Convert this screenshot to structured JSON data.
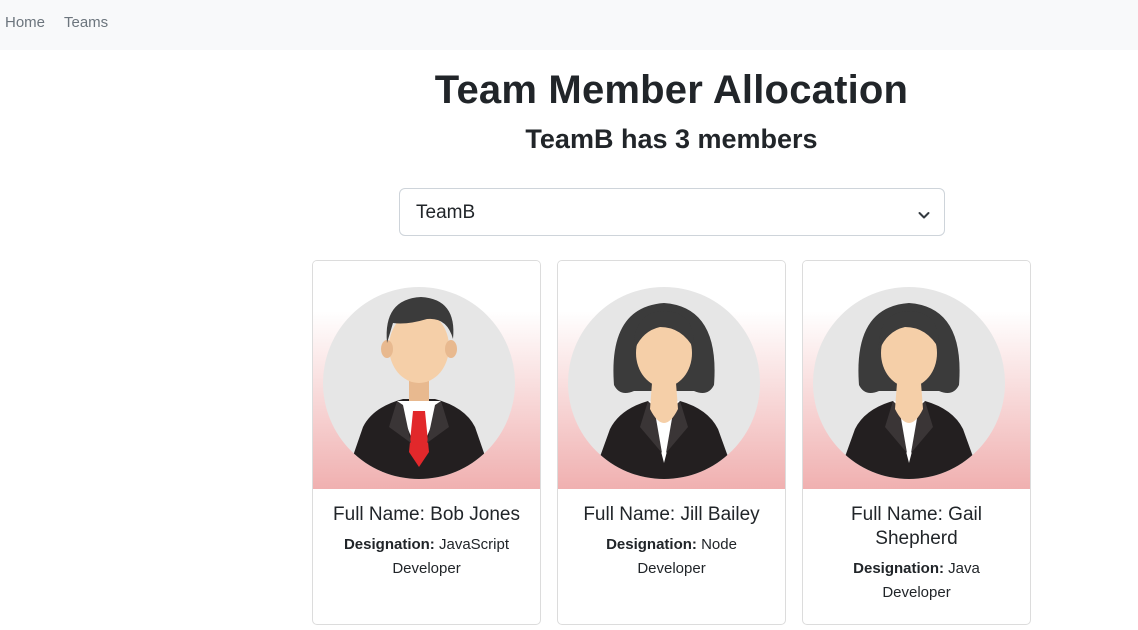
{
  "nav": {
    "home": "Home",
    "teams": "Teams"
  },
  "header": {
    "title": "Team Member Allocation",
    "subtitle": "TeamB has 3 members"
  },
  "team_select": {
    "selected": "TeamB"
  },
  "members": [
    {
      "name": "Full Name: Bob Jones",
      "designation_label": "Designation:",
      "designation": "JavaScript Developer",
      "avatar": "male-avatar"
    },
    {
      "name": "Full Name: Jill Bailey",
      "designation_label": "Designation:",
      "designation": "Node Developer",
      "avatar": "female-avatar"
    },
    {
      "name": "Full Name: Gail Shepherd",
      "designation_label": "Designation:",
      "designation": "Java Developer",
      "avatar": "female-avatar"
    }
  ]
}
